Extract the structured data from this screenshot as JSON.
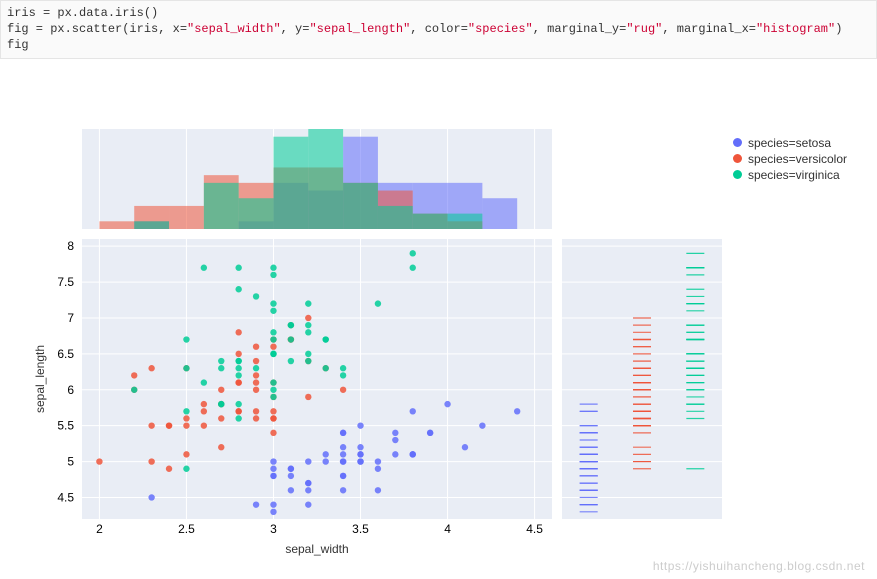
{
  "code_lines": [
    "iris = px.data.iris()",
    "fig = px.scatter(iris, x=\"sepal_width\", y=\"sepal_length\", color=\"species\", marginal_y=\"rug\", marginal_x=\"histogram\")",
    "fig"
  ],
  "watermark": "https://yishuihancheng.blog.csdn.net",
  "legend": {
    "items": [
      {
        "label": "species=setosa",
        "color": "#636efa"
      },
      {
        "label": "species=versicolor",
        "color": "#ef553b"
      },
      {
        "label": "species=virginica",
        "color": "#00cc96"
      }
    ]
  },
  "chart_data": {
    "type": "scatter",
    "xlabel": "sepal_width",
    "ylabel": "sepal_length",
    "xlim": [
      1.9,
      4.6
    ],
    "ylim": [
      4.2,
      8.1
    ],
    "xticks": [
      2,
      2.5,
      3,
      3.5,
      4,
      4.5
    ],
    "yticks": [
      4.5,
      5,
      5.5,
      6,
      6.5,
      7,
      7.5,
      8
    ],
    "marginal_x": "histogram",
    "marginal_y": "rug",
    "series": [
      {
        "name": "species=setosa",
        "color": "#636efa",
        "points": [
          [
            3.5,
            5.1
          ],
          [
            3.0,
            4.9
          ],
          [
            3.2,
            4.7
          ],
          [
            3.1,
            4.6
          ],
          [
            3.6,
            5.0
          ],
          [
            3.9,
            5.4
          ],
          [
            3.4,
            4.6
          ],
          [
            3.4,
            5.0
          ],
          [
            2.9,
            4.4
          ],
          [
            3.1,
            4.9
          ],
          [
            3.7,
            5.4
          ],
          [
            3.4,
            4.8
          ],
          [
            3.0,
            4.8
          ],
          [
            3.0,
            4.3
          ],
          [
            4.0,
            5.8
          ],
          [
            4.4,
            5.7
          ],
          [
            3.9,
            5.4
          ],
          [
            3.5,
            5.1
          ],
          [
            3.8,
            5.7
          ],
          [
            3.8,
            5.1
          ],
          [
            3.4,
            5.4
          ],
          [
            3.7,
            5.1
          ],
          [
            3.6,
            4.6
          ],
          [
            3.3,
            5.1
          ],
          [
            3.4,
            4.8
          ],
          [
            3.0,
            5.0
          ],
          [
            3.4,
            5.0
          ],
          [
            3.5,
            5.2
          ],
          [
            3.4,
            5.2
          ],
          [
            3.2,
            4.7
          ],
          [
            3.1,
            4.8
          ],
          [
            3.4,
            5.4
          ],
          [
            4.1,
            5.2
          ],
          [
            4.2,
            5.5
          ],
          [
            3.1,
            4.9
          ],
          [
            3.2,
            5.0
          ],
          [
            3.5,
            5.5
          ],
          [
            3.6,
            4.9
          ],
          [
            3.0,
            4.4
          ],
          [
            3.4,
            5.1
          ],
          [
            3.5,
            5.0
          ],
          [
            2.3,
            4.5
          ],
          [
            3.2,
            4.4
          ],
          [
            3.5,
            5.0
          ],
          [
            3.8,
            5.1
          ],
          [
            3.0,
            4.8
          ],
          [
            3.8,
            5.1
          ],
          [
            3.2,
            4.6
          ],
          [
            3.7,
            5.3
          ],
          [
            3.3,
            5.0
          ]
        ]
      },
      {
        "name": "species=versicolor",
        "color": "#ef553b",
        "points": [
          [
            3.2,
            7.0
          ],
          [
            3.2,
            6.4
          ],
          [
            3.1,
            6.9
          ],
          [
            2.3,
            5.5
          ],
          [
            2.8,
            6.5
          ],
          [
            2.8,
            5.7
          ],
          [
            3.3,
            6.3
          ],
          [
            2.4,
            4.9
          ],
          [
            2.9,
            6.6
          ],
          [
            2.7,
            5.2
          ],
          [
            2.0,
            5.0
          ],
          [
            3.0,
            5.9
          ],
          [
            2.2,
            6.0
          ],
          [
            2.9,
            6.1
          ],
          [
            2.9,
            5.6
          ],
          [
            3.1,
            6.7
          ],
          [
            3.0,
            5.6
          ],
          [
            2.7,
            5.8
          ],
          [
            2.2,
            6.2
          ],
          [
            2.5,
            5.6
          ],
          [
            3.2,
            5.9
          ],
          [
            2.8,
            6.1
          ],
          [
            2.5,
            6.3
          ],
          [
            2.8,
            6.1
          ],
          [
            2.9,
            6.4
          ],
          [
            3.0,
            6.6
          ],
          [
            2.8,
            6.8
          ],
          [
            3.0,
            6.7
          ],
          [
            2.9,
            6.0
          ],
          [
            2.6,
            5.7
          ],
          [
            2.4,
            5.5
          ],
          [
            2.4,
            5.5
          ],
          [
            2.7,
            5.8
          ],
          [
            2.7,
            6.0
          ],
          [
            3.0,
            5.4
          ],
          [
            3.4,
            6.0
          ],
          [
            3.1,
            6.7
          ],
          [
            2.3,
            6.3
          ],
          [
            3.0,
            5.6
          ],
          [
            2.5,
            5.5
          ],
          [
            2.6,
            5.5
          ],
          [
            3.0,
            6.1
          ],
          [
            2.6,
            5.8
          ],
          [
            2.3,
            5.0
          ],
          [
            2.7,
            5.6
          ],
          [
            3.0,
            5.7
          ],
          [
            2.9,
            5.7
          ],
          [
            2.9,
            6.2
          ],
          [
            2.5,
            5.1
          ],
          [
            2.8,
            5.7
          ]
        ]
      },
      {
        "name": "species=virginica",
        "color": "#00cc96",
        "points": [
          [
            3.3,
            6.3
          ],
          [
            2.7,
            5.8
          ],
          [
            3.0,
            7.1
          ],
          [
            2.9,
            6.3
          ],
          [
            3.0,
            6.5
          ],
          [
            3.0,
            7.6
          ],
          [
            2.5,
            4.9
          ],
          [
            2.9,
            7.3
          ],
          [
            2.5,
            6.7
          ],
          [
            3.6,
            7.2
          ],
          [
            3.2,
            6.5
          ],
          [
            2.7,
            6.4
          ],
          [
            3.0,
            6.8
          ],
          [
            2.5,
            5.7
          ],
          [
            2.8,
            5.8
          ],
          [
            3.2,
            6.4
          ],
          [
            3.0,
            6.5
          ],
          [
            3.8,
            7.7
          ],
          [
            2.6,
            7.7
          ],
          [
            2.2,
            6.0
          ],
          [
            3.2,
            6.9
          ],
          [
            2.8,
            5.6
          ],
          [
            2.8,
            7.7
          ],
          [
            2.7,
            6.3
          ],
          [
            3.3,
            6.7
          ],
          [
            3.2,
            7.2
          ],
          [
            2.8,
            6.2
          ],
          [
            3.0,
            6.1
          ],
          [
            2.8,
            6.4
          ],
          [
            3.0,
            7.2
          ],
          [
            2.8,
            7.4
          ],
          [
            3.8,
            7.9
          ],
          [
            2.8,
            6.4
          ],
          [
            2.8,
            6.3
          ],
          [
            2.6,
            6.1
          ],
          [
            3.0,
            7.7
          ],
          [
            3.4,
            6.3
          ],
          [
            3.1,
            6.4
          ],
          [
            3.0,
            6.0
          ],
          [
            3.1,
            6.9
          ],
          [
            3.1,
            6.7
          ],
          [
            3.1,
            6.9
          ],
          [
            2.7,
            5.8
          ],
          [
            3.2,
            6.8
          ],
          [
            3.3,
            6.7
          ],
          [
            3.0,
            6.7
          ],
          [
            2.5,
            6.3
          ],
          [
            3.0,
            6.5
          ],
          [
            3.4,
            6.2
          ],
          [
            3.0,
            5.9
          ]
        ]
      }
    ],
    "histogram": {
      "bin_edges": [
        2.0,
        2.2,
        2.4,
        2.6,
        2.8,
        3.0,
        3.2,
        3.4,
        3.6,
        3.8,
        4.0,
        4.2,
        4.4
      ],
      "series": [
        {
          "name": "species=setosa",
          "color": "#636efa",
          "counts": [
            0,
            1,
            0,
            0,
            1,
            6,
            5,
            12,
            6,
            6,
            6,
            4,
            3
          ]
        },
        {
          "name": "species=versicolor",
          "color": "#ef553b",
          "counts": [
            1,
            3,
            3,
            7,
            6,
            8,
            8,
            6,
            5,
            2,
            1,
            0,
            0
          ]
        },
        {
          "name": "species=virginica",
          "color": "#00cc96",
          "counts": [
            0,
            1,
            0,
            6,
            4,
            12,
            13,
            6,
            3,
            2,
            2,
            0,
            1
          ]
        }
      ],
      "ymax": 13
    }
  }
}
